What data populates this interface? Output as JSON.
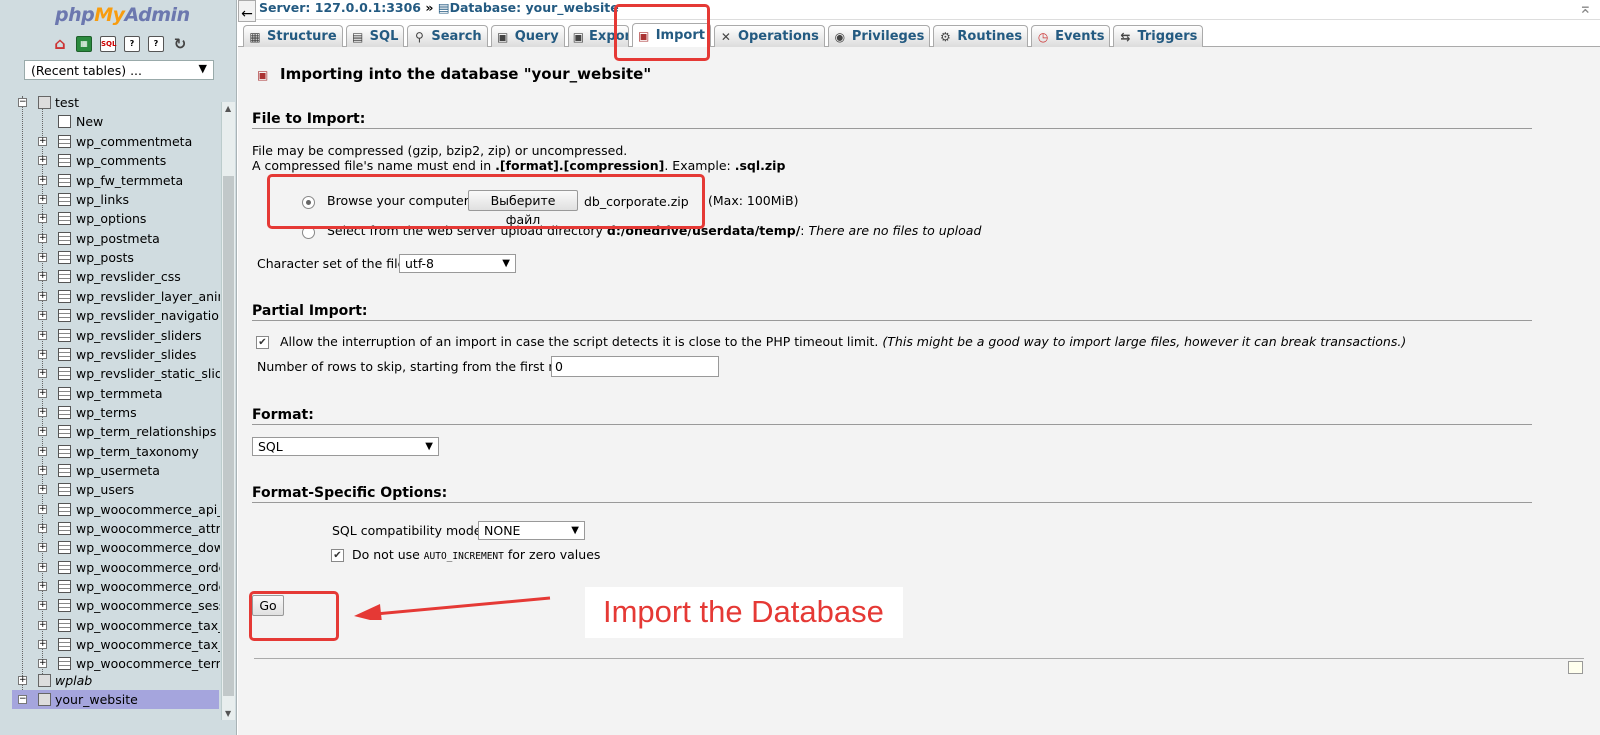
{
  "nav": {
    "logo": {
      "php": "php",
      "my": "My",
      "admin": "Admin"
    },
    "icons": [
      "home-icon",
      "grid-icon",
      "sql-icon",
      "docs-icon",
      "help-icon",
      "reload-icon"
    ],
    "recent_tables": "(Recent tables) ...",
    "tree": {
      "db_test": "test",
      "new_label": "New",
      "tables": [
        "wp_commentmeta",
        "wp_comments",
        "wp_fw_termmeta",
        "wp_links",
        "wp_options",
        "wp_postmeta",
        "wp_posts",
        "wp_revslider_css",
        "wp_revslider_layer_anima",
        "wp_revslider_navigations",
        "wp_revslider_sliders",
        "wp_revslider_slides",
        "wp_revslider_static_slides",
        "wp_termmeta",
        "wp_terms",
        "wp_term_relationships",
        "wp_term_taxonomy",
        "wp_usermeta",
        "wp_users",
        "wp_woocommerce_api_ke",
        "wp_woocommerce_attribu",
        "wp_woocommerce_downl",
        "wp_woocommerce_order_",
        "wp_woocommerce_order_",
        "wp_woocommerce_sessi",
        "wp_woocommerce_tax_ra",
        "wp_woocommerce_tax_ra",
        "wp_woocommerce_termm"
      ],
      "db_wplab": "wplab",
      "db_your_website": "your_website"
    }
  },
  "breadcrumb": {
    "server": "Server: 127.0.0.1:3306",
    "separator": "»",
    "database": "Database: your_website"
  },
  "tabs": [
    {
      "label": "Structure",
      "icon": "structure-icon"
    },
    {
      "label": "SQL",
      "icon": "sql-icon"
    },
    {
      "label": "Search",
      "icon": "search-icon"
    },
    {
      "label": "Query",
      "icon": "query-icon"
    },
    {
      "label": "Export",
      "icon": "export-icon"
    },
    {
      "label": "Import",
      "icon": "import-icon",
      "active": true
    },
    {
      "label": "Operations",
      "icon": "operations-icon"
    },
    {
      "label": "Privileges",
      "icon": "privileges-icon"
    },
    {
      "label": "Routines",
      "icon": "routines-icon"
    },
    {
      "label": "Events",
      "icon": "events-icon"
    },
    {
      "label": "Triggers",
      "icon": "triggers-icon"
    }
  ],
  "main": {
    "title": "Importing into the database \"your_website\"",
    "file_section": {
      "heading": "File to Import:",
      "line1": "File may be compressed (gzip, bzip2, zip) or uncompressed.",
      "line2_prefix": "A compressed file's name must end in ",
      "line2_format": ".[format].[compression]",
      "line2_mid": ". Example: ",
      "line2_example": ".sql.zip",
      "browse_label": "Browse your computer:",
      "browse_button": "Выберите файл",
      "file_name": "db_corporate.zip",
      "max_size": "(Max: 100MiB)",
      "server_label": "Select from the web server upload directory ",
      "server_dir": "d:/onedrive/userdata/temp/",
      "server_colon": ":",
      "no_files": "There are no files to upload",
      "charset_label": "Character set of the file:",
      "charset_value": "utf-8"
    },
    "partial_section": {
      "heading": "Partial Import:",
      "allow_interrupt": "Allow the interruption of an import in case the script detects it is close to the PHP timeout limit.",
      "allow_interrupt_note": "(This might be a good way to import large files, however it can break transactions.)",
      "skip_rows_label": "Number of rows to skip, starting from the first row:",
      "skip_rows_value": "0"
    },
    "format_section": {
      "heading": "Format:",
      "format_value": "SQL"
    },
    "options_section": {
      "heading": "Format-Specific Options:",
      "compat_label": "SQL compatibility mode:",
      "compat_value": "NONE",
      "no_auto_prefix": "Do not use ",
      "no_auto_code": "AUTO_INCREMENT",
      "no_auto_suffix": " for zero values"
    },
    "go_button": "Go"
  },
  "annotation": {
    "text": "Import the Database",
    "color": "#e53935"
  }
}
